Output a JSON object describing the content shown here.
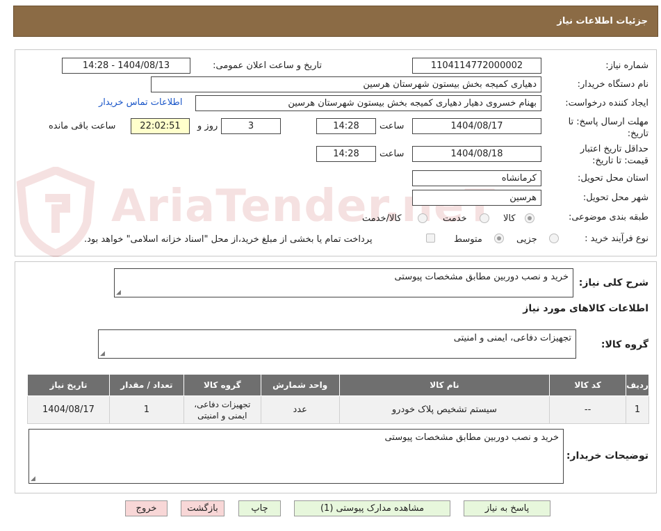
{
  "header": {
    "title": "جزئیات اطلاعات نیاز"
  },
  "info": {
    "need_number_label": "شماره نیاز:",
    "need_number": "1104114772000002",
    "announce_label": "تاریخ و ساعت اعلان عمومی:",
    "announce_value": "1404/08/13 - 14:28",
    "buyer_org_label": "نام دستگاه خریدار:",
    "buyer_org": "دهیاری کمیجه بخش بیستون شهرستان هرسین",
    "creator_label": "ایجاد کننده درخواست:",
    "creator": "بهنام خسروی دهیار دهیاری کمیجه بخش بیستون شهرستان هرسین",
    "contact_link": "اطلاعات تماس خریدار",
    "reply_deadline_label": "مهلت ارسال پاسخ: تا تاریخ:",
    "reply_date": "1404/08/17",
    "time_label": "ساعت",
    "reply_time": "14:28",
    "days_value": "3",
    "days_label": "روز و",
    "remaining_time": "22:02:51",
    "remaining_label": "ساعت باقی مانده",
    "validity_label": "حداقل تاریخ اعتبار قیمت: تا تاریخ:",
    "validity_date": "1404/08/18",
    "validity_time": "14:28",
    "province_label": "استان محل تحویل:",
    "province": "کرمانشاه",
    "city_label": "شهر محل تحویل:",
    "city": "هرسین",
    "category_label": "طبقه بندی موضوعی:",
    "category_options": [
      "کالا",
      "خدمت",
      "کالا/خدمت"
    ],
    "process_label": "نوع فرآیند خرید :",
    "process_options": [
      "جزیی",
      "متوسط"
    ],
    "payment_note": "پرداخت تمام یا بخشی از مبلغ خرید،از محل \"اسناد خزانه اسلامی\" خواهد بود."
  },
  "watermark": {
    "text": "AriaTender.neT"
  },
  "description": {
    "label": "شرح کلی نیاز:",
    "value": "خرید و نصب دوربین مطابق مشخصات پیوستی"
  },
  "goods": {
    "section_title": "اطلاعات کالاهای مورد نیاز",
    "group_label": "گروه کالا:",
    "group_value": "تجهیزات دفاعی، ایمنی و امنیتی",
    "columns": [
      "ردیف",
      "کد کالا",
      "نام کالا",
      "واحد شمارش",
      "گروه کالا",
      "تعداد / مقدار",
      "تاریخ نیاز"
    ],
    "rows": [
      {
        "row": "1",
        "code": "--",
        "name": "سیستم تشخیص پلاک خودرو",
        "unit": "عدد",
        "group": "تجهیزات دفاعی، ایمنی و امنیتی",
        "qty": "1",
        "date": "1404/08/17"
      }
    ]
  },
  "buyer_notes": {
    "label": "توضیحات خریدار:",
    "value": "خرید و نصب دوربین مطابق مشخصات پیوستی"
  },
  "buttons": {
    "reply": "پاسخ به نیاز",
    "attachments": "مشاهده مدارک پیوستی (1)",
    "print": "چاپ",
    "back": "بازگشت",
    "exit": "خروج"
  },
  "colors": {
    "header_bg": "#8b6b45",
    "table_header_bg": "#6f6f6f",
    "link": "#1a56c8",
    "highlight": "#ffffcc"
  }
}
